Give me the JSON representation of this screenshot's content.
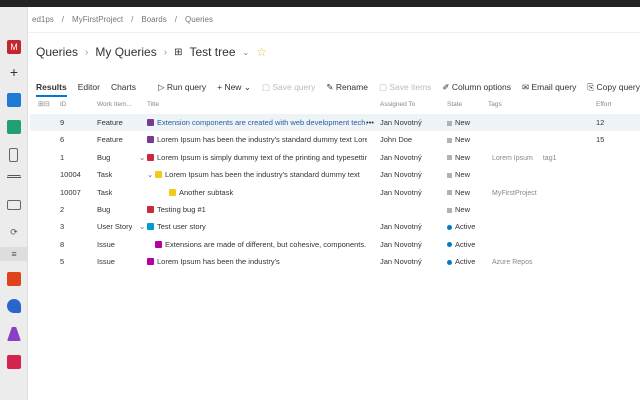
{
  "breadcrumb": [
    "ed1ps",
    "MyFirstProject",
    "Boards",
    "Queries"
  ],
  "sidebar": {
    "avatar": "M",
    "items": [
      "plus-icon",
      "overview-icon",
      "boards-icon",
      "repos-icon",
      "pipelines-icon",
      "test-plans-icon",
      "artifacts-icon",
      "queries-icon",
      "extension-icon",
      "rocket-icon",
      "flask-icon",
      "package-icon"
    ]
  },
  "header": {
    "root": "Queries",
    "folder": "My Queries",
    "query": "Test tree"
  },
  "toolbar": {
    "tabs": [
      "Results",
      "Editor",
      "Charts"
    ],
    "run": "Run query",
    "new": "New",
    "save": "Save query",
    "rename": "Rename",
    "save_items": "Save items",
    "columns": "Column options",
    "email": "Email query",
    "copy": "Copy query URL"
  },
  "columns": {
    "id": "ID",
    "type": "Work Item...",
    "title": "Title",
    "assigned": "Assigned To",
    "state": "State",
    "tags": "Tags",
    "effort": "Effort"
  },
  "colors": {
    "accent": "#0078d4",
    "new": "#b2b2b2",
    "active": "#007acc",
    "feature": "#773b93",
    "bug": "#cc293d",
    "task": "#f2cb1d",
    "story": "#009ccc",
    "issue": "#b4009e"
  },
  "rows": [
    {
      "id": "9",
      "type": "Feature",
      "title": "Extension components are created with web development tech...",
      "assigned": "Jan Novotný",
      "state": "New",
      "tags": [],
      "effort": "12",
      "indent": 0,
      "chev": false
    },
    {
      "id": "6",
      "type": "Feature",
      "title": "Lorem Ipsum has been the industry's standard dummy text Lorem i...",
      "assigned": "John Doe",
      "state": "New",
      "tags": [],
      "effort": "15",
      "indent": 0,
      "chev": false
    },
    {
      "id": "1",
      "type": "Bug",
      "title": "Lorem Ipsum is simply dummy text of the printing and typesetting in...",
      "assigned": "Jan Novotný",
      "state": "New",
      "tags": [
        "Lorem Ipsum",
        "tag1"
      ],
      "effort": "",
      "indent": 0,
      "chev": true
    },
    {
      "id": "10004",
      "type": "Task",
      "title": "Lorem Ipsum has been the industry's standard dummy text",
      "assigned": "Jan Novotný",
      "state": "New",
      "tags": [],
      "effort": "",
      "indent": 1,
      "chev": true
    },
    {
      "id": "10007",
      "type": "Task",
      "title": "Another subtask",
      "assigned": "Jan Novotný",
      "state": "New",
      "tags": [
        "MyFirstProject"
      ],
      "effort": "",
      "indent": 2,
      "chev": false
    },
    {
      "id": "2",
      "type": "Bug",
      "title": "Testing bug #1",
      "assigned": "",
      "state": "New",
      "tags": [],
      "effort": "",
      "indent": 0,
      "chev": false
    },
    {
      "id": "3",
      "type": "User Story",
      "title": "Test user story",
      "assigned": "Jan Novotný",
      "state": "Active",
      "tags": [],
      "effort": "",
      "indent": 0,
      "chev": true
    },
    {
      "id": "8",
      "type": "Issue",
      "title": "Extensions are made of different, but cohesive, components.",
      "assigned": "Jan Novotný",
      "state": "Active",
      "tags": [],
      "effort": "",
      "indent": 1,
      "chev": false
    },
    {
      "id": "5",
      "type": "Issue",
      "title": "Lorem Ipsum has been the industry's",
      "assigned": "Jan Novotný",
      "state": "Active",
      "tags": [
        "Azure Repos"
      ],
      "effort": "",
      "indent": 0,
      "chev": false
    }
  ]
}
